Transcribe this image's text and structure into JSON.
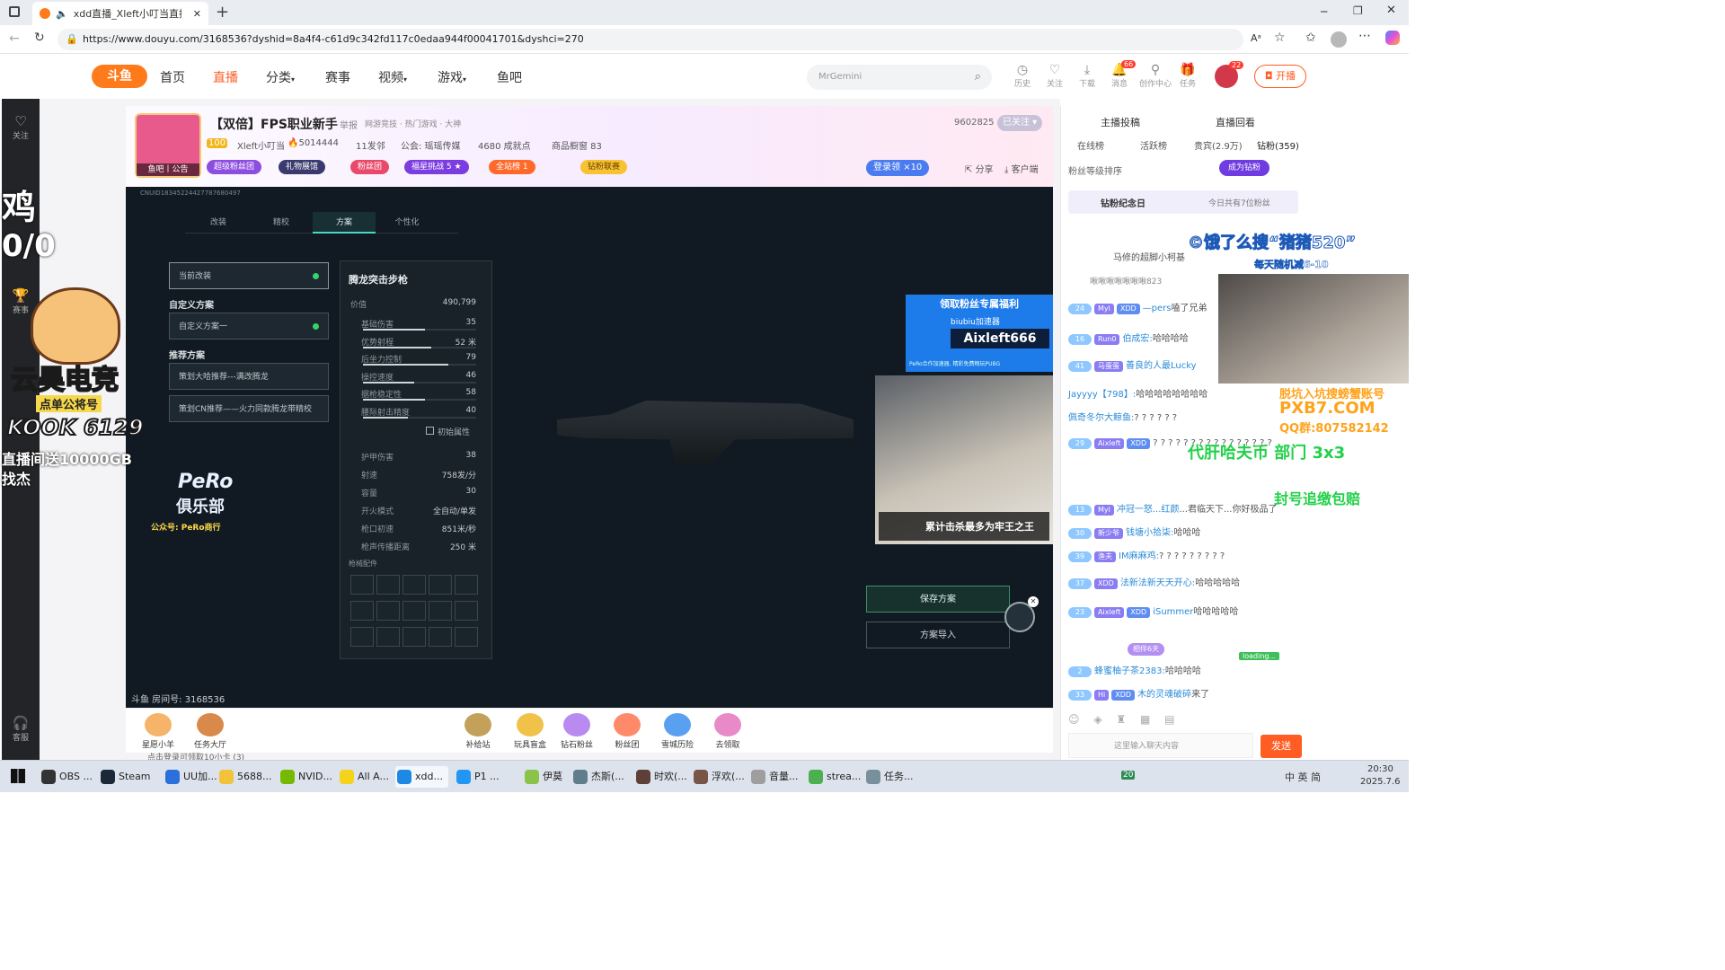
{
  "browser": {
    "tab_title": "xdd直播_Xleft小叮当直播_xd",
    "url": "https://www.douyu.com/3168536?dyshid=8a4f4-c61d9c342fd117c0edaa944f00041701&dyshci=270"
  },
  "site": {
    "logo": "斗鱼",
    "nav": [
      "首页",
      "直播",
      "分类",
      "赛事",
      "视频",
      "游戏",
      "鱼吧"
    ],
    "search_placeholder": "MrGemini",
    "top_icons": [
      "历史",
      "关注",
      "下载",
      "消息",
      "创作中心",
      "任务"
    ],
    "badge_msg": "66",
    "badge_user": "22",
    "open_btn": "开播"
  },
  "sidebar": {
    "items": [
      "关注",
      "赛事",
      "客服"
    ]
  },
  "room": {
    "title": "【双倍】FPS职业新手",
    "report": "举报",
    "breadcrumb": "网游竞技 · 热门游戏 · 大神",
    "streamer": "Xleft小叮当",
    "level": "100",
    "hot": "5014444",
    "fans": "11发邻",
    "union": "公会: 瑶瑶传媒",
    "achieve": "4680 成就点",
    "merch": "商品橱窗 83",
    "follow_count": "9602825",
    "follow_btn": "已关注",
    "pills": [
      "超级粉丝团",
      "礼物展馆",
      "粉丝团",
      "福星挑战 5 ★",
      "全站榜 1",
      "钻粉联赛"
    ],
    "login_gift": "登录领",
    "login_mult": "×10",
    "share": "分享",
    "client": "客户端",
    "fish_bar": "鱼吧丨公告"
  },
  "game": {
    "tabs": [
      "改装",
      "精校",
      "方案",
      "个性化"
    ],
    "current_mod": "当前改装",
    "custom_header": "自定义方案",
    "custom_item": "自定义方案一",
    "recommend_header": "推荐方案",
    "rec1": "策划大哈推荐---满改腾龙",
    "rec2": "策划CN推荐——火力同款腾龙带精校",
    "weapon": "腾龙突击步枪",
    "price_label": "价值",
    "price": "490,799",
    "stats": [
      [
        "基础伤害",
        "35",
        0.55
      ],
      [
        "优势射程",
        "52 米",
        0.6
      ],
      [
        "后坐力控制",
        "79",
        0.75
      ],
      [
        "操控速度",
        "46",
        0.45
      ],
      [
        "据枪稳定性",
        "58",
        0.55
      ],
      [
        "腰际射击精度",
        "40",
        0.4
      ]
    ],
    "init_attr": "初始属性",
    "stats2": [
      [
        "护甲伤害",
        "38"
      ],
      [
        "射速",
        "758发/分"
      ],
      [
        "容量",
        "30"
      ],
      [
        "开火模式",
        "全自动/单发"
      ],
      [
        "枪口初速",
        "851米/秒"
      ],
      [
        "枪声传播距离",
        "250 米"
      ]
    ],
    "attach_label": "枪械配件",
    "save": "保存方案",
    "import": "方案导入",
    "room_id": "斗鱼 房间号: 3168536",
    "fan_welfare": "领取粉丝专属福利",
    "biubiu": "biubiu加速器",
    "biubiu_code": "Aixleft666",
    "biubiu_note": "PeRo合作加速器, 精彩免费畅玩PUBG",
    "cam_caption": "累计击杀最多为牢王之王",
    "uid_watermark": "CNUID18345224427787680497"
  },
  "overlay": {
    "left_big1": "鸡",
    "left_big2": "0/0",
    "brand": "云昊电竞",
    "brand_sub": "点单公将号",
    "kook": "KOOK 6129",
    "live_line": "直播间送10000GB",
    "find": "找杰",
    "pero": "PeRo",
    "pero_club": "俱乐部",
    "pero_wechat": "公众号: PeRo商行",
    "ad1": "©饿了么搜“猪猪520”",
    "ad1_sub": "每天随机减6-10",
    "ad2": "脱坑入坑搜螃蟹账号",
    "ad2_domain": "PXB7.COM",
    "ad2_qq": "QQ群:807582142",
    "ad3": "代肝哈夫币 部门 3x3",
    "ad4": "封号追缴包赔"
  },
  "chat": {
    "top1": "主播投稿",
    "top2": "直播回看",
    "tabs": [
      "在线榜",
      "活跃榜",
      "贵宾(2.9万)",
      "钻粉(359)"
    ],
    "rank_sort": "粉丝等级排序",
    "become_diamond": "成为钻粉",
    "anniv": "钻粉纪念日",
    "anniv_count": "今日共有7位粉丝",
    "rank1": "马修的超脚小柯基",
    "rank2": "啾啾啾啾啾啾啾823",
    "messages": [
      [
        "24",
        "Myl",
        "XDD",
        "—pers",
        "嗑了兄弟"
      ],
      [
        "16",
        "Run0",
        "",
        "伯成宏:",
        "哈哈哈哈"
      ],
      [
        "41",
        "马蛋蛋",
        "",
        "善良的人最Lucky",
        ""
      ],
      [
        "",
        "",
        "",
        "Jayyyy【798】:",
        "哈哈哈哈哈哈哈哈"
      ],
      [
        "",
        "",
        "",
        "佩奇冬尔大鲸鱼:",
        "? ? ? ? ? ?"
      ],
      [
        "29",
        "Aixleft",
        "XDD",
        "",
        "? ? ? ? ? ? ? ? ? ? ? ? ? ? ? ?"
      ],
      [
        "13",
        "Myl",
        "",
        "冲冠一怒...红颜",
        "...君临天下...你好极品了"
      ],
      [
        "30",
        "新少爷",
        "",
        "钱塘小拾柒:",
        "哈哈哈"
      ],
      [
        "39",
        "渔夫",
        "",
        "IM麻麻鸡:",
        "? ? ? ? ? ? ? ? ?"
      ],
      [
        "37",
        "XDD",
        "",
        "法新法新天天开心:",
        "哈哈哈哈哈"
      ],
      [
        "23",
        "Aixleft",
        "XDD",
        "iSummer",
        "哈哈哈哈哈"
      ],
      [
        "2",
        "",
        "",
        "蜂蜜柚子茶2383:",
        "哈哈哈哈"
      ],
      [
        "33",
        "Hi",
        "XDD",
        "木的灵魂破碎",
        "来了"
      ]
    ],
    "input_placeholder": "这里输入聊天内容",
    "send": "发送",
    "guard_days": "相伴6天",
    "loading": "loading..."
  },
  "gifts": [
    "星愿小羊",
    "任务大厅",
    "补给站",
    "玩具盲盒",
    "钻石粉丝",
    "粉丝团",
    "雪城历险",
    "去领取"
  ],
  "bottom_strip": "点击登录可领取10小卡 (3)",
  "taskbar": {
    "apps": [
      "OBS ...",
      "Steam",
      "UU加...",
      "5688...",
      "NVID...",
      "All A...",
      "xdd...",
      "P1 ...",
      "伊莫",
      "杰斯(...",
      "时欢(...",
      "浮欢(...",
      "音量...",
      "strea...",
      "任务..."
    ],
    "tray": "中 英 简",
    "time": "20:30",
    "date": "2025.7.6",
    "tray_num": "20"
  },
  "colors": {
    "accent": "#ff5d23",
    "teal": "#4bd7c3",
    "game_bg": "#111a22"
  }
}
